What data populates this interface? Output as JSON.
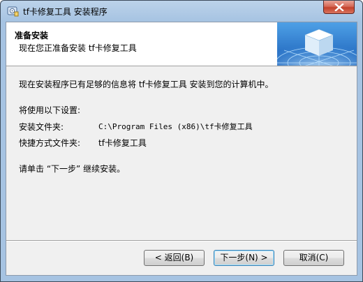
{
  "window": {
    "title": "tf卡修复工具 安装程序"
  },
  "header": {
    "title": "准备安装",
    "subtitle": "现在您正准备安装 tf卡修复工具"
  },
  "content": {
    "intro": "现在安装程序已有足够的信息将 tf卡修复工具 安装到您的计算机中。",
    "settings_heading": "将使用以下设置:",
    "install_folder_label": "安装文件夹:",
    "install_folder_value": "C:\\Program Files (x86)\\tf卡修复工具",
    "shortcut_folder_label": "快捷方式文件夹:",
    "shortcut_folder_value": "tf卡修复工具",
    "instruction": "请单击 “下一步” 继续安装。"
  },
  "buttons": {
    "back": "< 返回(B)",
    "next": "下一步(N) >",
    "cancel": "取消(C)"
  },
  "colors": {
    "titlebar": "#a6c3e2",
    "close_button": "#c3412b",
    "client_bg": "#f0f0f0"
  }
}
